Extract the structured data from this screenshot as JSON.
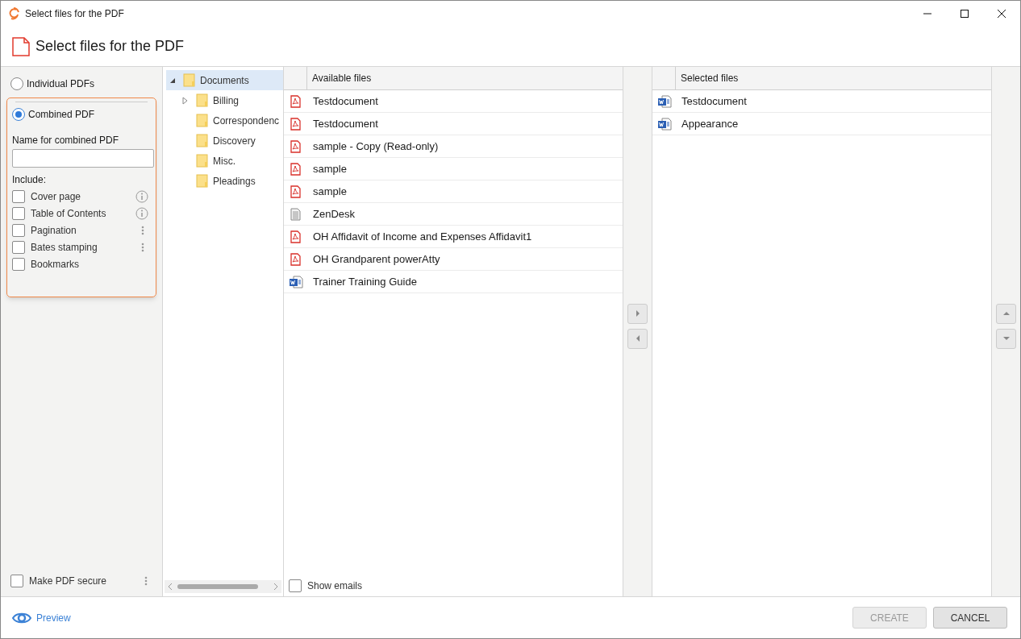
{
  "window": {
    "title": "Select files for the PDF"
  },
  "header": {
    "title": "Select files for the PDF"
  },
  "output_modes": [
    {
      "label": "Individual PDFs",
      "selected": false
    },
    {
      "label": "Combined PDF",
      "selected": true
    }
  ],
  "combined": {
    "name_label": "Name for combined PDF",
    "include_label": "Include:",
    "options": [
      {
        "label": "Cover page",
        "checked": false,
        "kind": "info"
      },
      {
        "label": "Table of Contents",
        "checked": false,
        "kind": "info"
      },
      {
        "label": "Pagination",
        "checked": false,
        "kind": "menu"
      },
      {
        "label": "Bates stamping",
        "checked": false,
        "kind": "menu"
      },
      {
        "label": "Bookmarks",
        "checked": false,
        "kind": "plain"
      }
    ]
  },
  "secure": {
    "label": "Make PDF secure",
    "checked": false
  },
  "tree": [
    {
      "label": "Documents",
      "selected": true,
      "expanded": true,
      "children": [
        {
          "label": "Billing",
          "selected": false,
          "expanded": false
        },
        {
          "label": "Correspondenc",
          "selected": false
        },
        {
          "label": "Discovery",
          "selected": false
        },
        {
          "label": "Misc.",
          "selected": false
        },
        {
          "label": "Pleadings",
          "selected": false
        }
      ]
    }
  ],
  "available": {
    "column": "Available files",
    "rows": [
      {
        "name": "Testdocument",
        "kind": "pdf"
      },
      {
        "name": "Testdocument",
        "kind": "pdf"
      },
      {
        "name": "sample - Copy (Read-only)",
        "kind": "pdf"
      },
      {
        "name": "sample",
        "kind": "pdf"
      },
      {
        "name": "sample",
        "kind": "pdf"
      },
      {
        "name": "ZenDesk",
        "kind": "text"
      },
      {
        "name": "OH Affidavit of Income and Expenses Affidavit1",
        "kind": "pdf"
      },
      {
        "name": "OH Grandparent powerAtty",
        "kind": "pdf"
      },
      {
        "name": "Trainer Training Guide",
        "kind": "word"
      }
    ],
    "show_emails": {
      "label": "Show emails",
      "checked": false
    }
  },
  "selected_files": {
    "column": "Selected files",
    "rows": [
      {
        "name": "Testdocument",
        "kind": "word"
      },
      {
        "name": "Appearance",
        "kind": "word"
      }
    ]
  },
  "footer": {
    "preview": "Preview",
    "buttons": [
      {
        "label": "CREATE",
        "disabled": true
      },
      {
        "label": "CANCEL",
        "disabled": false
      }
    ]
  }
}
